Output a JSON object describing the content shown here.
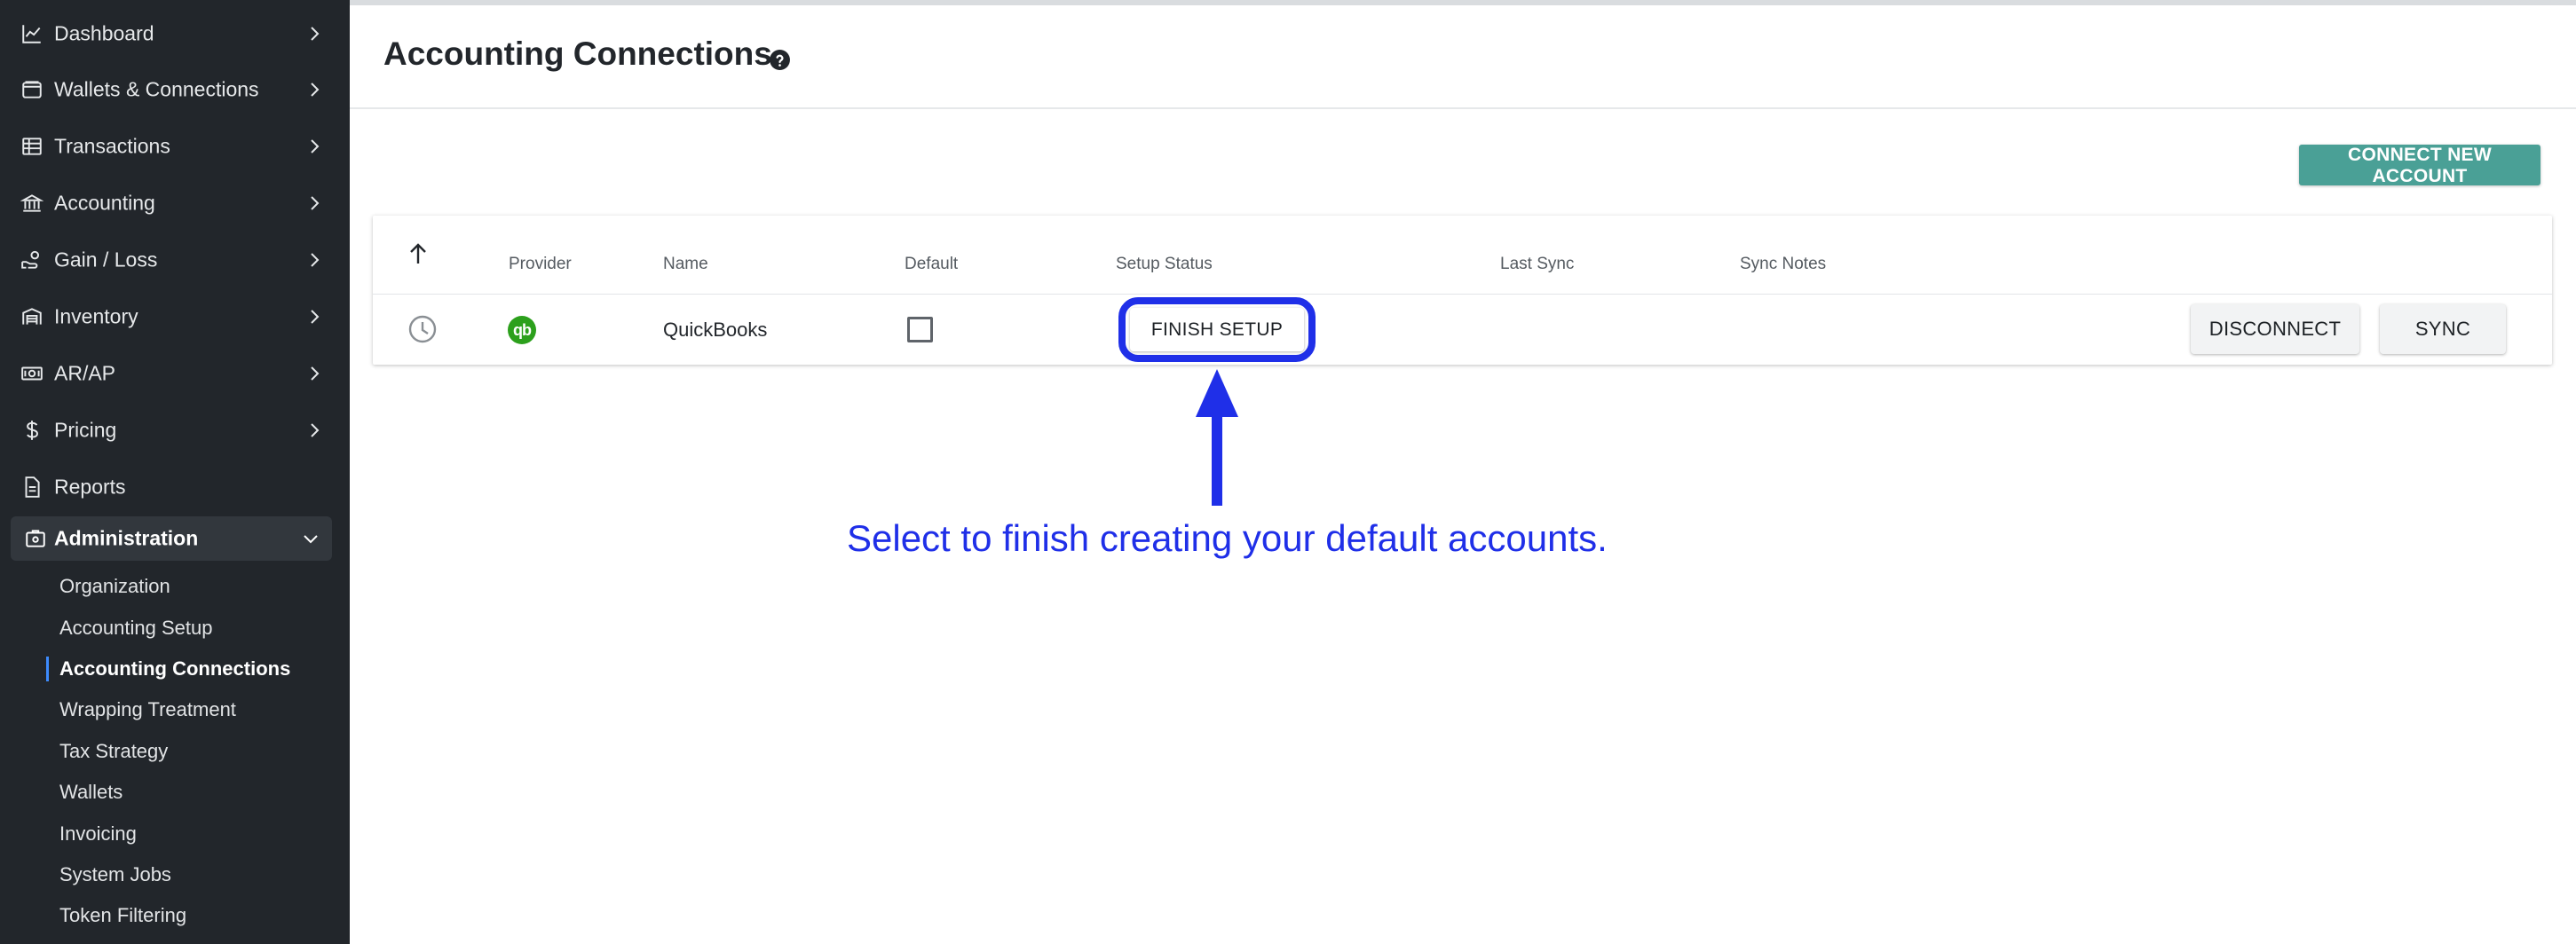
{
  "sidebar": {
    "items": [
      {
        "label": "Dashboard",
        "icon": "chart-line-icon"
      },
      {
        "label": "Wallets & Connections",
        "icon": "wallet-icon"
      },
      {
        "label": "Transactions",
        "icon": "table-icon"
      },
      {
        "label": "Accounting",
        "icon": "bank-icon"
      },
      {
        "label": "Gain / Loss",
        "icon": "hand-coin-icon"
      },
      {
        "label": "Inventory",
        "icon": "warehouse-icon"
      },
      {
        "label": "AR/AP",
        "icon": "cash-icon"
      },
      {
        "label": "Pricing",
        "icon": "dollar-icon"
      },
      {
        "label": "Reports",
        "icon": "document-icon"
      },
      {
        "label": "Administration",
        "icon": "admin-icon"
      }
    ],
    "admin_subitems": [
      "Organization",
      "Accounting Setup",
      "Accounting Connections",
      "Wrapping Treatment",
      "Tax Strategy",
      "Wallets",
      "Invoicing",
      "System Jobs",
      "Token Filtering"
    ],
    "current_subitem": "Accounting Connections"
  },
  "page": {
    "title": "Accounting Connections",
    "connect_button": "CONNECT NEW ACCOUNT"
  },
  "table": {
    "headers": {
      "provider": "Provider",
      "name": "Name",
      "default": "Default",
      "setup_status": "Setup Status",
      "last_sync": "Last Sync",
      "sync_notes": "Sync Notes"
    },
    "row": {
      "provider_logo_text": "qb",
      "name": "QuickBooks",
      "default_checked": false,
      "setup_button": "FINISH SETUP",
      "disconnect_button": "DISCONNECT",
      "sync_button": "SYNC"
    }
  },
  "annotation": {
    "text": "Select to finish creating your default accounts.",
    "color": "#1f2fe8"
  },
  "colors": {
    "sidebar_bg": "#22262b",
    "accent_teal": "#4aa096",
    "quickbooks_green": "#2ca01c"
  }
}
